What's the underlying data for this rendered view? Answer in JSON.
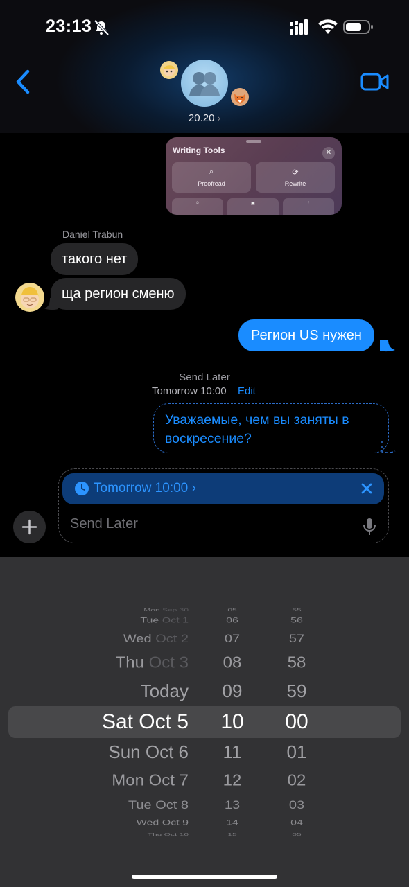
{
  "status_bar": {
    "time": "23:13"
  },
  "header": {
    "group_name": "20.20",
    "chevron": "›"
  },
  "writing_tools": {
    "title": "Writing Tools",
    "close": "✕",
    "proofread": "Proofread",
    "rewrite": "Rewrite"
  },
  "messages": {
    "sender": "Daniel Trabun",
    "incoming": [
      "такого нет",
      "ща регион сменю"
    ],
    "outgoing": "Регион US нужен",
    "send_later_label": "Send Later",
    "send_later_time": "Tomorrow 10:00",
    "send_later_edit": "Edit",
    "scheduled_text": "Уважаемые, чем вы заняты в воскресение?"
  },
  "compose": {
    "chip_label": "Tomorrow 10:00 ›",
    "placeholder": "Send Later"
  },
  "picker": {
    "rows": [
      {
        "date_strong": "Mon",
        "date_dim": " Sep 30",
        "hour": "05",
        "minute": "55"
      },
      {
        "date_strong": "Tue",
        "date_dim": " Oct 1",
        "hour": "06",
        "minute": "56"
      },
      {
        "date_strong": "Wed",
        "date_dim": " Oct 2",
        "hour": "07",
        "minute": "57"
      },
      {
        "date_strong": "Thu",
        "date_dim": " Oct 3",
        "hour": "08",
        "minute": "58"
      },
      {
        "date_strong": "Today",
        "date_dim": "",
        "hour": "09",
        "minute": "59"
      },
      {
        "date_strong": "Sat Oct 5",
        "date_dim": "",
        "hour": "10",
        "minute": "00"
      },
      {
        "date_strong": "Sun Oct 6",
        "date_dim": "",
        "hour": "11",
        "minute": "01"
      },
      {
        "date_strong": "Mon Oct 7",
        "date_dim": "",
        "hour": "12",
        "minute": "02"
      },
      {
        "date_strong": "Tue Oct 8",
        "date_dim": "",
        "hour": "13",
        "minute": "03"
      },
      {
        "date_strong": "Wed Oct 9",
        "date_dim": "",
        "hour": "14",
        "minute": "04"
      },
      {
        "date_strong": "Thu Oct 10",
        "date_dim": "",
        "hour": "15",
        "minute": "05"
      }
    ]
  },
  "colors": {
    "accent": "#1a8cff",
    "bubble_incoming": "#262628",
    "picker_bg": "#323234"
  }
}
